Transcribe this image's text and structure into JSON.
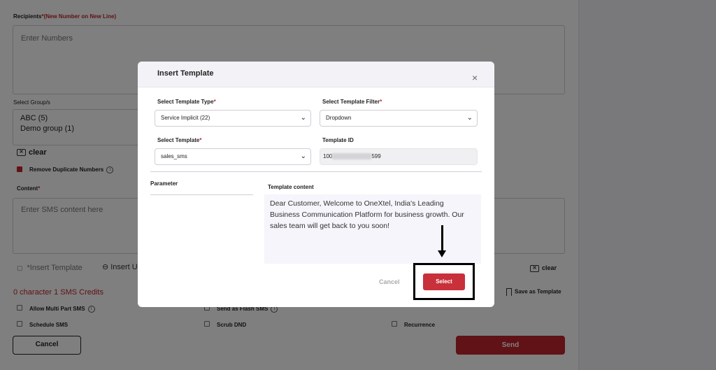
{
  "background": {
    "recipients_label": "Recipients",
    "recipients_required": "*",
    "recipients_note": "(New Number on New Line)",
    "recipients_placeholder": "Enter Numbers",
    "select_groups_label": "Select Group/s",
    "groups": [
      "ABC (5)",
      "Demo group (1)"
    ],
    "clear_label": "clear",
    "remove_duplicates_label": "Remove Duplicate Numbers",
    "content_label": "Content",
    "content_required": "*",
    "content_placeholder": "Enter SMS content here",
    "insert_template_label": "*Insert Template",
    "insert_link_label": "Insert U",
    "clear_content_label": "clear",
    "credits_text": "0 character 1 SMS Credits",
    "save_as_template_label": "Save as Template",
    "options": {
      "allow_multi_part": "Allow Multi Part SMS",
      "send_as_flash": "Send as Flash SMS",
      "schedule_sms": "Schedule SMS",
      "scrub_dnd": "Scrub DND",
      "recurrence": "Recurrence"
    },
    "cancel_label": "Cancel",
    "send_label": "Send"
  },
  "modal": {
    "title": "Insert Template",
    "close_glyph": "×",
    "template_type_label": "Select Template Type",
    "template_type_value": "Service Implicit (22)",
    "template_filter_label": "Select Template Filter",
    "template_filter_value": "Dropdown",
    "template_label": "Select Template",
    "template_value": "sales_sms",
    "template_id_label": "Template ID",
    "template_id_prefix": "100",
    "template_id_suffix": "599",
    "required_mark": "*",
    "parameter_label": "Parameter",
    "template_content_label": "Template content",
    "template_content": "Dear Customer, Welcome to OneXtel, India's Leading Business Communication Platform for business growth. Our sales team will get back to you soon!",
    "cancel_label": "Cancel",
    "select_label": "Select"
  },
  "colors": {
    "accent": "#c0242e",
    "overlay": "rgba(0,0,0,0.5)",
    "modal_header": "#f3f2f7"
  },
  "icons": {
    "close": "close-icon",
    "chevron": "chevron-down-icon",
    "info": "info-icon",
    "clear": "clear-icon",
    "link": "link-icon",
    "template": "template-icon",
    "bookmark": "bookmark-icon",
    "annotation_arrow": "arrow-down-icon"
  }
}
